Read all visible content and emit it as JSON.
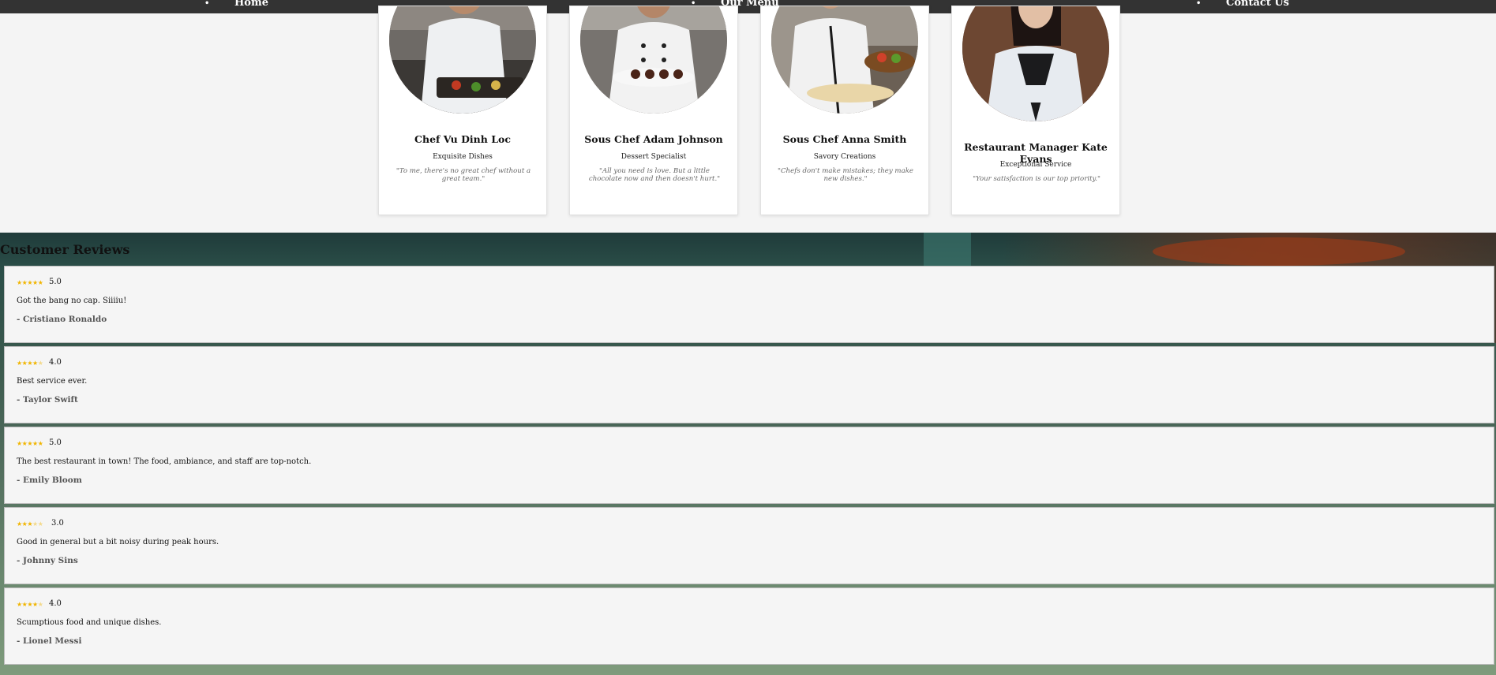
{
  "nav": {
    "items": [
      {
        "label": "Home"
      },
      {
        "label": "Our Menu"
      },
      {
        "label": "Contact Us"
      }
    ]
  },
  "team": [
    {
      "name": "Chef Vu Dinh Loc",
      "role": "Exquisite Dishes",
      "quote": "\"To me, there's no great chef without a great team.\""
    },
    {
      "name": "Sous Chef Adam Johnson",
      "role": "Dessert Specialist",
      "quote": "\"All you need is love. But a little chocolate now and then doesn't hurt.\""
    },
    {
      "name": "Sous Chef Anna Smith",
      "role": "Savory Creations",
      "quote": "\"Chefs don't make mistakes; they make new dishes.\""
    },
    {
      "name": "Restaurant Manager Kate Evans",
      "role": "Exceptional Service",
      "quote": "\"Your satisfaction is our top priority.\""
    }
  ],
  "reviews": {
    "title": "Customer Reviews",
    "items": [
      {
        "stars": "★★★★★",
        "stars_off": "",
        "rating": "5.0",
        "filled": 5,
        "text": "Got the bang no cap. Siiiiu!",
        "author": "- Cristiano Ronaldo"
      },
      {
        "stars": "★★★★",
        "stars_off": "★",
        "rating": "4.0",
        "filled": 4,
        "text": "Best service ever.",
        "author": "- Taylor Swift"
      },
      {
        "stars": "★★★★★",
        "stars_off": "",
        "rating": "5.0",
        "filled": 5,
        "text": "The best restaurant in town! The food, ambiance, and staff are top-notch.",
        "author": "- Emily Bloom"
      },
      {
        "stars": "★★★",
        "stars_off": "★★",
        "rating": "3.0",
        "filled": 3,
        "text": "Good in general but a bit noisy during peak hours.",
        "author": "- Johnny Sins"
      },
      {
        "stars": "★★★★",
        "stars_off": "★",
        "rating": "4.0",
        "filled": 4,
        "text": "Scumptious food and unique dishes.",
        "author": "- Lionel Messi"
      }
    ]
  },
  "colors": {
    "nav_bg": "#333333",
    "star": "#f1b500",
    "card_bg": "#ffffff",
    "page_bg": "#f4f4f4"
  }
}
